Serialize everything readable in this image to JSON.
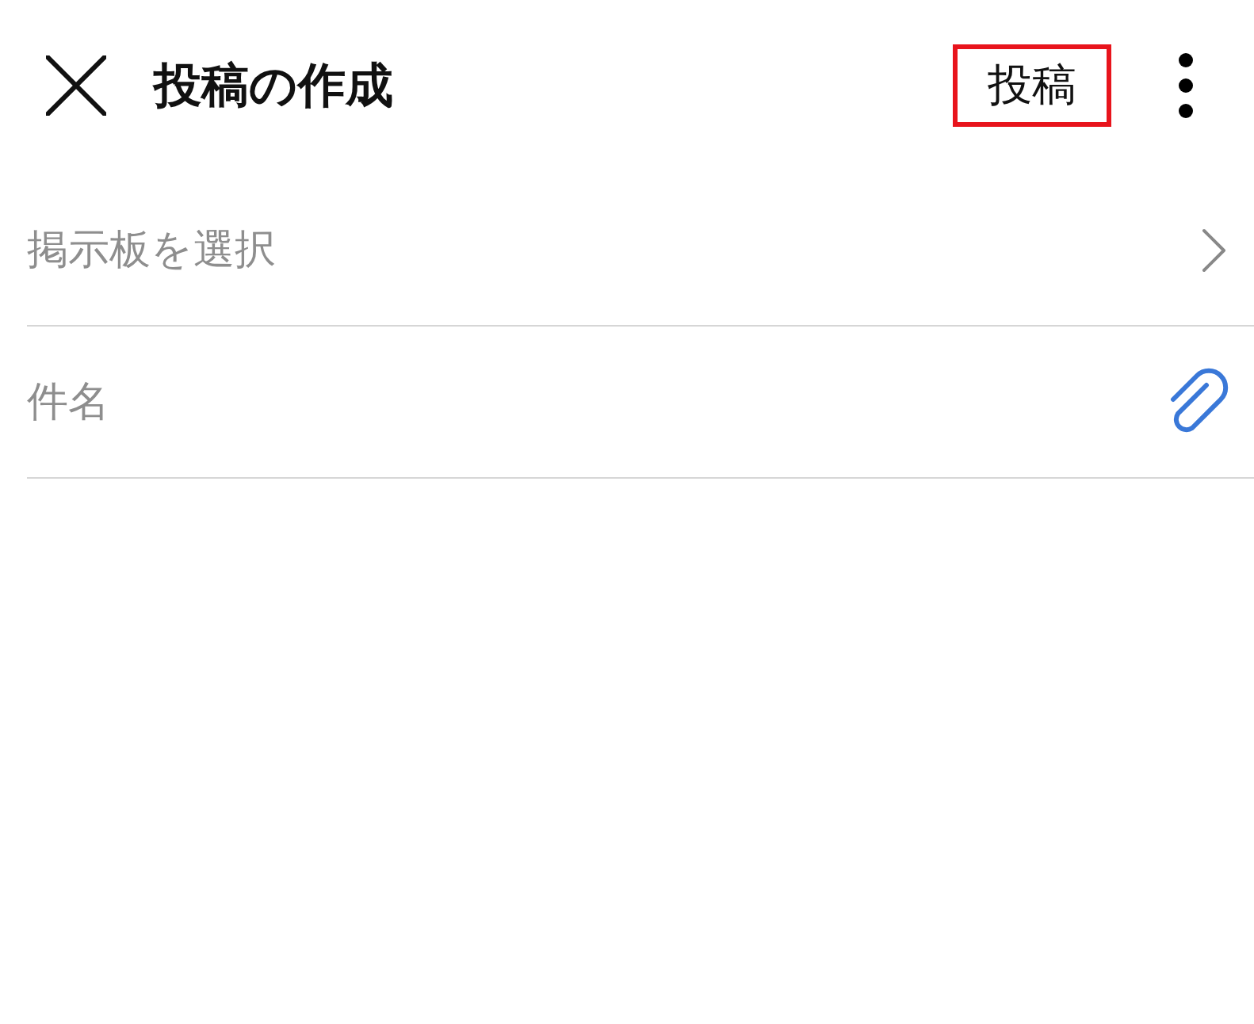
{
  "header": {
    "title": "投稿の作成",
    "post_button": {
      "label": "投稿",
      "highlighted": true
    }
  },
  "board_selector": {
    "label": "掲示板を選択"
  },
  "subject": {
    "placeholder": "件名"
  }
}
